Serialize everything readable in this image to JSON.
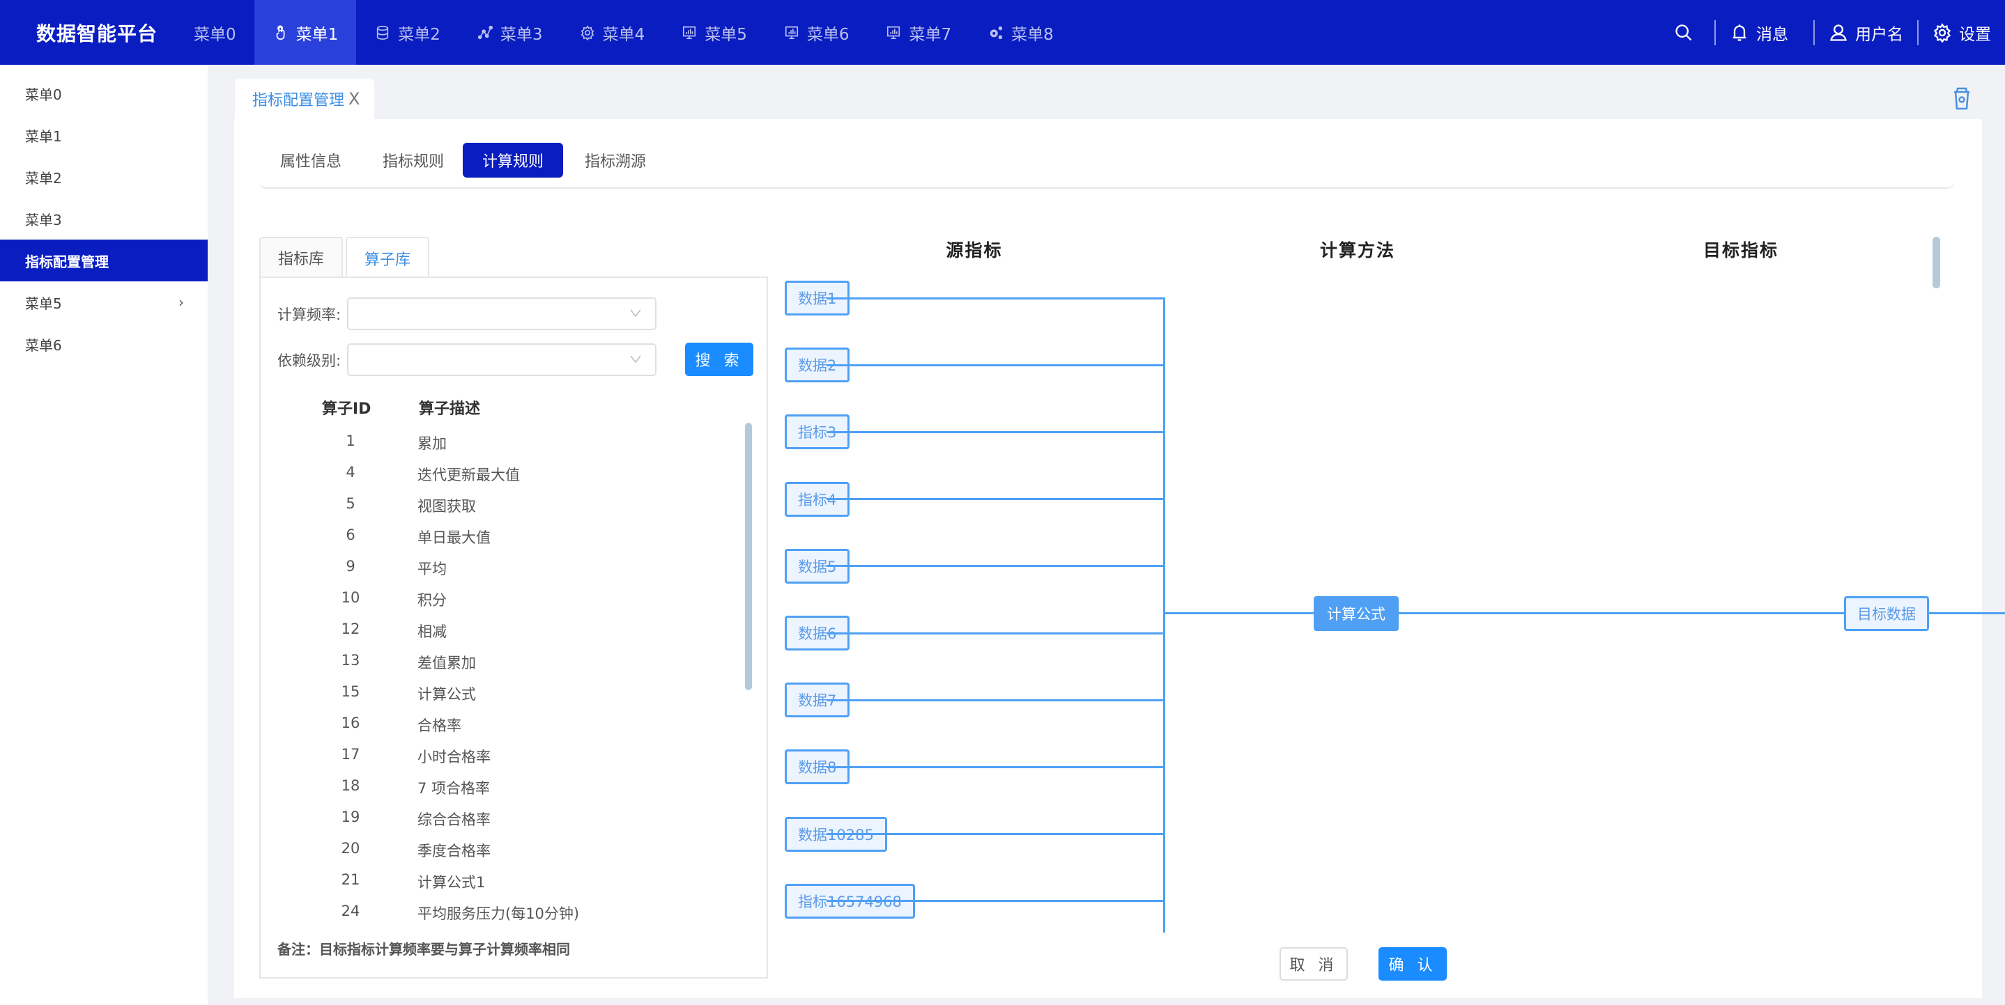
{
  "header": {
    "brand": "数据智能平台",
    "nav": [
      {
        "label": "菜单0",
        "icon": "none",
        "active": false
      },
      {
        "label": "菜单1",
        "icon": "hand-pointer-icon",
        "active": true
      },
      {
        "label": "菜单2",
        "icon": "database-icon",
        "active": false
      },
      {
        "label": "菜单3",
        "icon": "line-nodes-icon",
        "active": false
      },
      {
        "label": "菜单4",
        "icon": "gear-icon",
        "active": false
      },
      {
        "label": "菜单5",
        "icon": "monitor-chart-icon",
        "active": false
      },
      {
        "label": "菜单6",
        "icon": "monitor-chart-icon",
        "active": false
      },
      {
        "label": "菜单7",
        "icon": "monitor-chart-icon",
        "active": false
      },
      {
        "label": "菜单8",
        "icon": "gears-icon",
        "active": false
      }
    ],
    "messages_label": "消息",
    "username_label": "用户名",
    "settings_label": "设置"
  },
  "sidebar": {
    "items": [
      {
        "label": "菜单0",
        "active": false,
        "has_children": false
      },
      {
        "label": "菜单1",
        "active": false,
        "has_children": false
      },
      {
        "label": "菜单2",
        "active": false,
        "has_children": false
      },
      {
        "label": "菜单3",
        "active": false,
        "has_children": false
      },
      {
        "label": "指标配置管理",
        "active": true,
        "has_children": false
      },
      {
        "label": "菜单5",
        "active": false,
        "has_children": true
      },
      {
        "label": "菜单6",
        "active": false,
        "has_children": false
      }
    ],
    "chevron": "›"
  },
  "page_tab": {
    "label": "指标配置管理",
    "close": "X"
  },
  "subtabs": [
    {
      "label": "属性信息",
      "active": false
    },
    {
      "label": "指标规则",
      "active": false
    },
    {
      "label": "计算规则",
      "active": true
    },
    {
      "label": "指标溯源",
      "active": false
    }
  ],
  "library": {
    "tabs": [
      {
        "label": "指标库",
        "active": false
      },
      {
        "label": "算子库",
        "active": true
      }
    ],
    "filters": {
      "frequency_label": "计算频率:",
      "frequency_value": "",
      "dependency_label": "依赖级别:",
      "dependency_value": ""
    },
    "search_label": "搜 索",
    "columns": {
      "id": "算子ID",
      "desc": "算子描述"
    },
    "rows": [
      {
        "id": "1",
        "desc": "累加"
      },
      {
        "id": "4",
        "desc": "迭代更新最大值"
      },
      {
        "id": "5",
        "desc": "视图获取"
      },
      {
        "id": "6",
        "desc": "单日最大值"
      },
      {
        "id": "9",
        "desc": "平均"
      },
      {
        "id": "10",
        "desc": "积分"
      },
      {
        "id": "12",
        "desc": "相减"
      },
      {
        "id": "13",
        "desc": "差值累加"
      },
      {
        "id": "15",
        "desc": "计算公式"
      },
      {
        "id": "16",
        "desc": "合格率"
      },
      {
        "id": "17",
        "desc": "小时合格率"
      },
      {
        "id": "18",
        "desc": "7 项合格率"
      },
      {
        "id": "19",
        "desc": "综合合格率"
      },
      {
        "id": "20",
        "desc": "季度合格率"
      },
      {
        "id": "21",
        "desc": "计算公式1"
      },
      {
        "id": "24",
        "desc": "平均服务压力(每10分钟)"
      }
    ],
    "note": "备注：目标指标计算频率要与算子计算频率相同"
  },
  "diagram": {
    "titles": {
      "source": "源指标",
      "method": "计算方法",
      "target": "目标指标"
    },
    "sources": [
      "数据1",
      "数据2",
      "指标3",
      "指标4",
      "数据5",
      "数据6",
      "数据7",
      "数据8",
      "数据10285",
      "指标16574968"
    ],
    "method": "计算公式",
    "target": "目标数据",
    "accent_color": "#4fa0f5"
  },
  "actions": {
    "cancel": "取 消",
    "confirm": "确 认"
  },
  "colors": {
    "brand": "#0a1dc0",
    "primary": "#1a8cff",
    "link": "#3a8ee6"
  }
}
